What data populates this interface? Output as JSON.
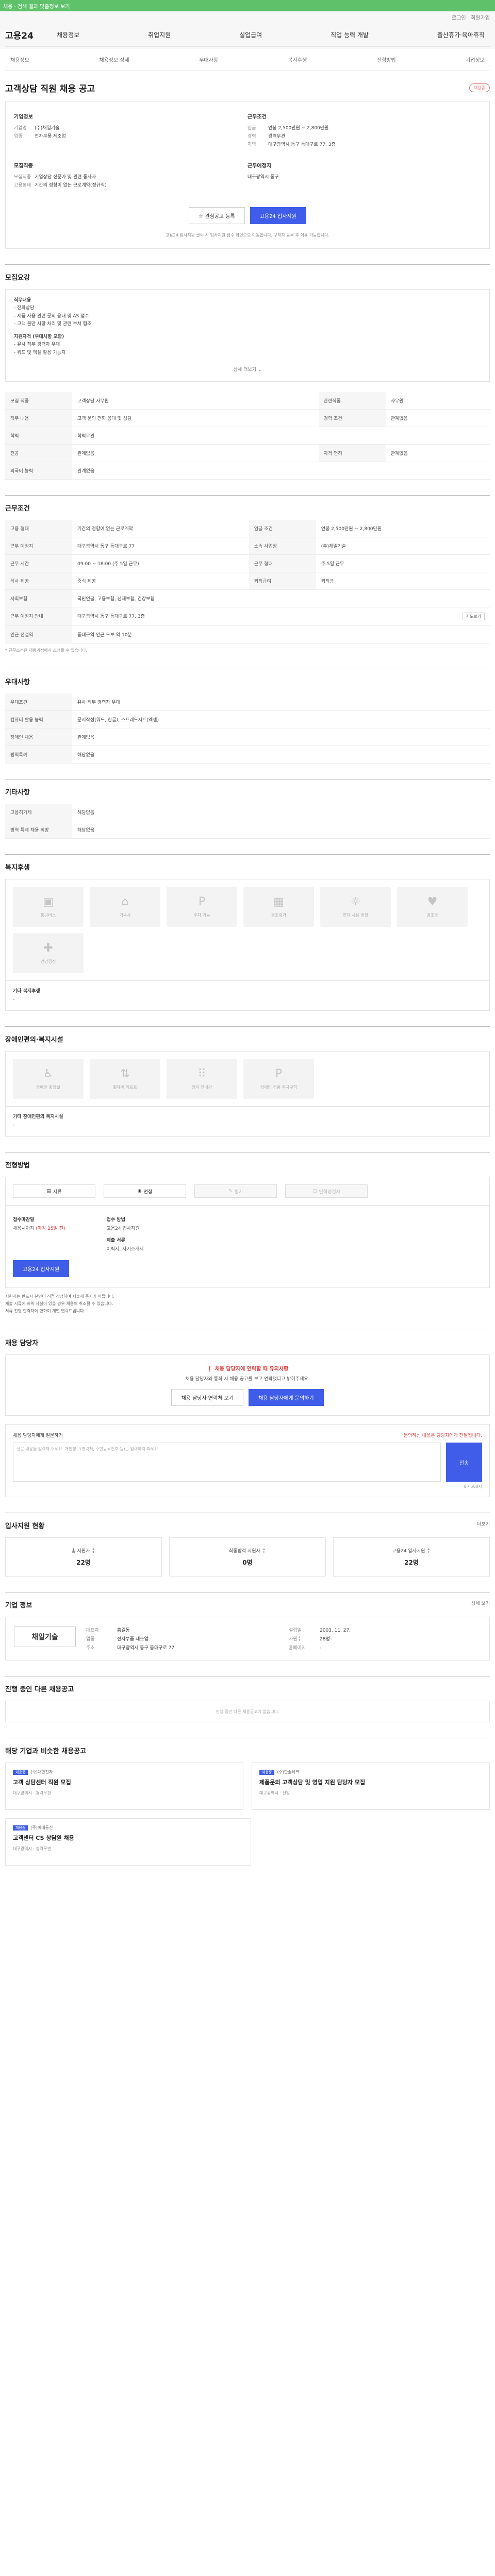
{
  "topbar": {
    "text": "채용 · 검색 결과 맞춤정보 보기"
  },
  "header": {
    "login": "로그인",
    "join": "회원가입",
    "logo": "고용24",
    "menu": [
      "채용정보",
      "취업지원",
      "실업급여",
      "직업 능력 개발",
      "출산휴가·육아휴직"
    ]
  },
  "lnb": [
    "채용정보",
    "채용정보 상세",
    "우대사항",
    "복지후생",
    "전형방법",
    "기업정보"
  ],
  "job": {
    "title": "고객상담 직원 채용 공고",
    "badge": "채용중",
    "company_label": "기업정보",
    "cond_label": "근무조건",
    "company": {
      "name_k": "기업명",
      "name_v": "(주)채일기술",
      "biz_k": "업종",
      "biz_v": "전자부품 제조업"
    },
    "cond": {
      "pay_k": "임금",
      "pay_v": "연봉 2,500만원 ~ 2,800만원",
      "form_k": "경력",
      "form_v": "경력무관",
      "loc_k": "지역",
      "loc_v": "대구광역시 동구 동대구로 77, 3층"
    },
    "apply_label": "모집직종",
    "apply": {
      "occ_k": "모집직종",
      "occ_v": "기업상담 전문가 및 관련 종사자",
      "acad_k": "고용형태",
      "acad_v": "기간의 정함이 없는 근로계약(정규직)",
      "loc_k": "근무예정지",
      "loc_v": "대구광역시 동구"
    },
    "scrap": "관심공고 등록",
    "apply_btn": "고용24 입사지원",
    "notice": "고용24 입사지원 클릭 시 입사지원 접수 화면으로 이동합니다. 구직자 등록 후 이용 가능합니다."
  },
  "summary": {
    "title": "모집요강",
    "lines": [
      "직무내용",
      "- 전화상담",
      "- 제품 사용 관련 문의 응대 및 AS 접수",
      "- 고객 불만 사항 처리 및 관련 부서 협조",
      "지원자격 (우대사항 포함)",
      "- 유사 직무 경력자 우대",
      "- 워드 및 엑셀 활용 가능자"
    ],
    "more": "상세 더보기"
  },
  "detail": {
    "rows": [
      [
        "모집 직종",
        "고객상담 사무원",
        "관련직종",
        "사무원"
      ],
      [
        "직무 내용",
        "고객 문의 전화 응대 및 상담",
        "경력 조건",
        "관계없음"
      ],
      [
        "학력",
        "학력무관",
        "",
        ""
      ],
      [
        "전공",
        "관계없음",
        "자격 면허",
        "관계없음"
      ],
      [
        "외국어 능력",
        "관계없음",
        "",
        ""
      ]
    ]
  },
  "work": {
    "title": "근무조건",
    "rows": [
      [
        "고용 형태",
        "기간의 정함이 없는 근로계약",
        "임금 조건",
        "연봉 2,500만원 ~ 2,800만원"
      ],
      [
        "근무 예정지",
        "대구광역시 동구 동대구로 77",
        "소속 사업장",
        "(주)채일기술"
      ],
      [
        "근무 시간",
        "09:00 ~ 18:00 (주 5일 근무)",
        "근무 형태",
        "주 5일 근무"
      ],
      [
        "식사 제공",
        "중식 제공",
        "퇴직급여",
        "퇴직금"
      ],
      [
        "사회보험",
        "국민연금, 고용보험, 산재보험, 건강보험",
        "",
        ""
      ],
      [
        "근무 예정지 안내",
        "대구광역시 동구 동대구로 77, 3층",
        "",
        ""
      ],
      [
        "인근 전철역",
        "동대구역 인근 도보 약 10분",
        "",
        ""
      ]
    ],
    "map": "지도보기",
    "note": "* 근무조건은 채용과정에서 조정될 수 있습니다."
  },
  "pref": {
    "title": "우대사항",
    "rows": [
      [
        "우대조건",
        "유사 직무 경력자 우대"
      ],
      [
        "컴퓨터 활용 능력",
        "문서작성(워드, 한글), 스프레드시트(엑셀)"
      ],
      [
        "장애인 채용",
        "관계없음"
      ],
      [
        "병역특례",
        "해당없음"
      ]
    ]
  },
  "other": {
    "title": "기타사항",
    "rows": [
      [
        "고용허가제",
        "해당없음"
      ],
      [
        "병역 특례 채용 희망",
        "해당없음"
      ]
    ]
  },
  "welfare": {
    "title": "복지후생",
    "items": [
      "통근버스",
      "기숙사",
      "주차 가능",
      "경조휴가",
      "연차 사용 권장",
      "경조금",
      "건강검진"
    ],
    "etc_label": "기타 복지후생",
    "etc_val": "-"
  },
  "disab": {
    "title": "장애인편의·복지시설",
    "items": [
      "장애인 화장실",
      "휠체어 리프트",
      "점자 안내판",
      "장애인 전용 주차구역"
    ],
    "etc_label": "기타 장애인편의 복지시설",
    "etc_val": "-"
  },
  "screen": {
    "title": "전형방법",
    "methods": [
      "서류",
      "면접",
      "필기",
      "인적성검사"
    ],
    "dead_label": "접수마감일",
    "dead_val": "채용시까지",
    "dead_red": "(마감 25일 전)",
    "how_label": "접수 방법",
    "how_val": "고용24 입사지원",
    "doc_label": "제출 서류",
    "doc_val": "이력서, 자기소개서",
    "apply_btn": "고용24 입사지원",
    "bullets": [
      "지원서는 반드시 본인이 직접 작성하여 제출해 주시기 바랍니다.",
      "제출 서류에 허위 사실이 있을 경우 채용이 취소될 수 있습니다.",
      "서류 전형 합격자에 한하여 개별 연락드립니다."
    ]
  },
  "manager": {
    "title": "채용 담당자",
    "alert": "채용 담당자에 연락할 때 유의사항",
    "alert_desc": "채용 담당자와 통화 시 채용 공고를 보고 연락했다고 밝혀주세요.",
    "btn1": "채용 담당자 연락처 보기",
    "btn2": "채용 담당자에게 문의하기",
    "q_label": "채용 담당자에게 질문하기",
    "q_note": "문의하신 내용은 담당자에게 전달됩니다.",
    "q_placeholder": "질문 내용을 입력해 주세요. 개인정보(연락처, 주민등록번호 등)는 입력하지 마세요.",
    "q_count": "0 / 500자",
    "q_btn": "전송"
  },
  "stats": {
    "title": "입사지원 현황",
    "more": "더보기",
    "items": [
      {
        "label": "총 지원자 수",
        "value": "22명"
      },
      {
        "label": "최종합격 지원자 수",
        "value": "0명"
      },
      {
        "label": "고용24 입사지원 수",
        "value": "22명"
      }
    ]
  },
  "info": {
    "title": "기업 정보",
    "rows": [
      [
        "대표자",
        "홍길동",
        "설립일",
        "2003. 11. 27."
      ],
      [
        "업종",
        "전자부품 제조업",
        "사원수",
        "28명"
      ],
      [
        "주소",
        "대구광역시 동구 동대구로 77",
        "홈페이지",
        "-"
      ]
    ],
    "logo": "채일기술"
  },
  "company_more": {
    "title": "기업 정보",
    "open": "상세 보기"
  },
  "other_jobs": {
    "title": "진행 중인 다른 채용공고",
    "empty": "진행 중인 다른 채용공고가 없습니다."
  },
  "similar": {
    "title": "해당 기업과 비슷한 채용공고",
    "cards": [
      {
        "tag": "채용중",
        "comp": "(주)대한전자",
        "title": "고객 상담센터 직원 모집",
        "meta": "대구광역시 · 경력무관"
      },
      {
        "tag": "채용중",
        "comp": "(주)한솔테크",
        "title": "제품문의 고객상담 및 영업 지원 담당자 모집",
        "meta": "대구광역시 · 신입"
      },
      {
        "tag": "채용중",
        "comp": "(주)미래통신",
        "title": "고객센터 CS 상담원 채용",
        "meta": "대구광역시 · 경력무관"
      }
    ]
  }
}
